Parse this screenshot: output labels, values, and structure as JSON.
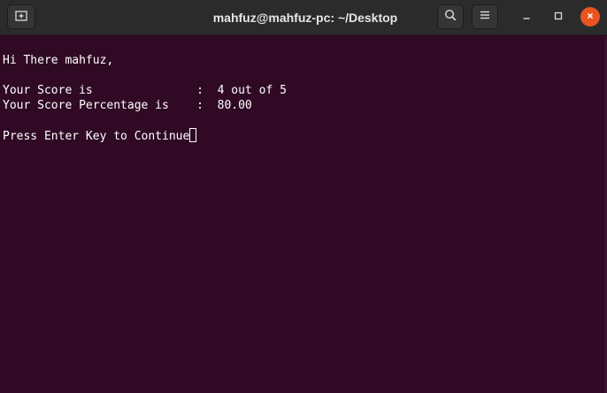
{
  "window": {
    "title": "mahfuz@mahfuz-pc: ~/Desktop",
    "background_color": "#300a24",
    "close_button_color": "#e95420"
  },
  "titlebar": {
    "icons": {
      "new_tab": "new-tab-icon",
      "search": "search-icon",
      "menu": "hamburger-menu-icon",
      "minimize": "minimize-icon",
      "maximize": "maximize-icon",
      "close": "close-icon"
    }
  },
  "terminal": {
    "lines": {
      "greeting": "Hi There mahfuz,",
      "score": "Your Score is               :  4 out of 5",
      "percentage": "Your Score Percentage is    :  80.00",
      "prompt": "Press Enter Key to Continue"
    }
  }
}
